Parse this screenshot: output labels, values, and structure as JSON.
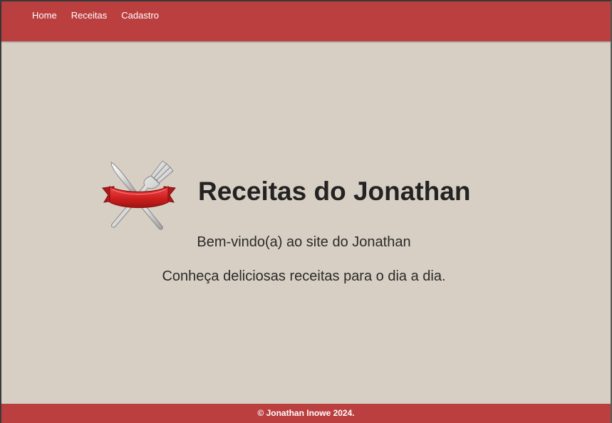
{
  "nav": {
    "items": [
      {
        "label": "Home"
      },
      {
        "label": "Receitas"
      },
      {
        "label": "Cadastro"
      }
    ]
  },
  "hero": {
    "logo_icon": "crossed-knife-fork-ribbon-icon",
    "title": "Receitas do Jonathan",
    "welcome": "Bem-vindo(a) ao site do Jonathan",
    "tagline": "Conheça deliciosas receitas para o dia a dia."
  },
  "footer": {
    "text": "© Jonathan Inowe 2024."
  },
  "colors": {
    "brand": "#bb3f3f",
    "background": "#d7cfc4",
    "text": "#232323"
  }
}
